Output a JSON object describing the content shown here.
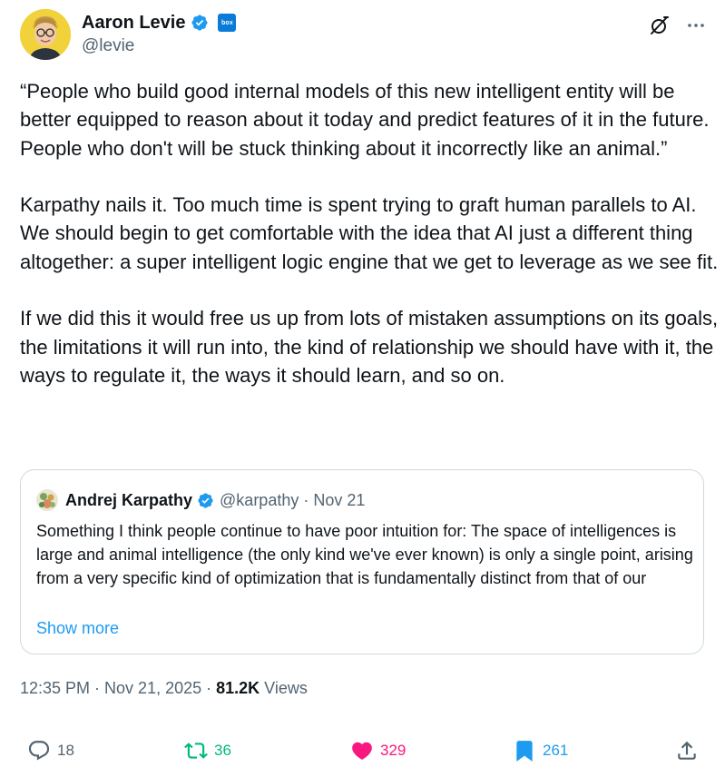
{
  "author": {
    "display_name": "Aaron Levie",
    "handle": "@levie",
    "affiliate_badge": "box"
  },
  "tweet": {
    "paragraphs": [
      "“People who build good internal models of this new intelligent entity will be better equipped to reason about it today and predict features of it in the future. People who don't will be stuck thinking about it incorrectly like an animal.”",
      "Karpathy nails it. Too much time is spent trying to graft human parallels to AI. We should begin to get comfortable with the idea that AI just a different thing altogether: a super intelligent logic engine that we get to leverage as we see fit.",
      "If we did this it would free us up from lots of mistaken assumptions on its goals, the limitations it will run into, the kind of relationship we should have with it, the ways to regulate it, the ways it should learn, and so on."
    ]
  },
  "quote": {
    "display_name": "Andrej Karpathy",
    "handle": "@karpathy",
    "date": "· Nov 21",
    "text": "Something I think people continue to have poor intuition for: The space of intelligences is large and animal intelligence (the only kind we've ever known) is only a single point, arising from a very specific kind of optimization that is fundamentally distinct from that of our",
    "show_more": "Show more"
  },
  "meta": {
    "timestamp": "12:35 PM · Nov 21, 2025 · ",
    "views_count": "81.2K",
    "views_label": " Views"
  },
  "actions": {
    "replies": "18",
    "reposts": "36",
    "likes": "329",
    "bookmarks": "261"
  },
  "colors": {
    "text": "#0f1419",
    "secondary": "#536471",
    "link": "#1d9bf0",
    "repost": "#00ba7c",
    "like": "#f91880",
    "border": "#cfd9de"
  },
  "icons": {
    "verified": "verified-badge-icon",
    "grok": "grok-icon",
    "more": "more-icon",
    "reply": "reply-icon",
    "repost": "repost-icon",
    "like": "heart-icon",
    "bookmark": "bookmark-icon",
    "share": "share-icon"
  }
}
